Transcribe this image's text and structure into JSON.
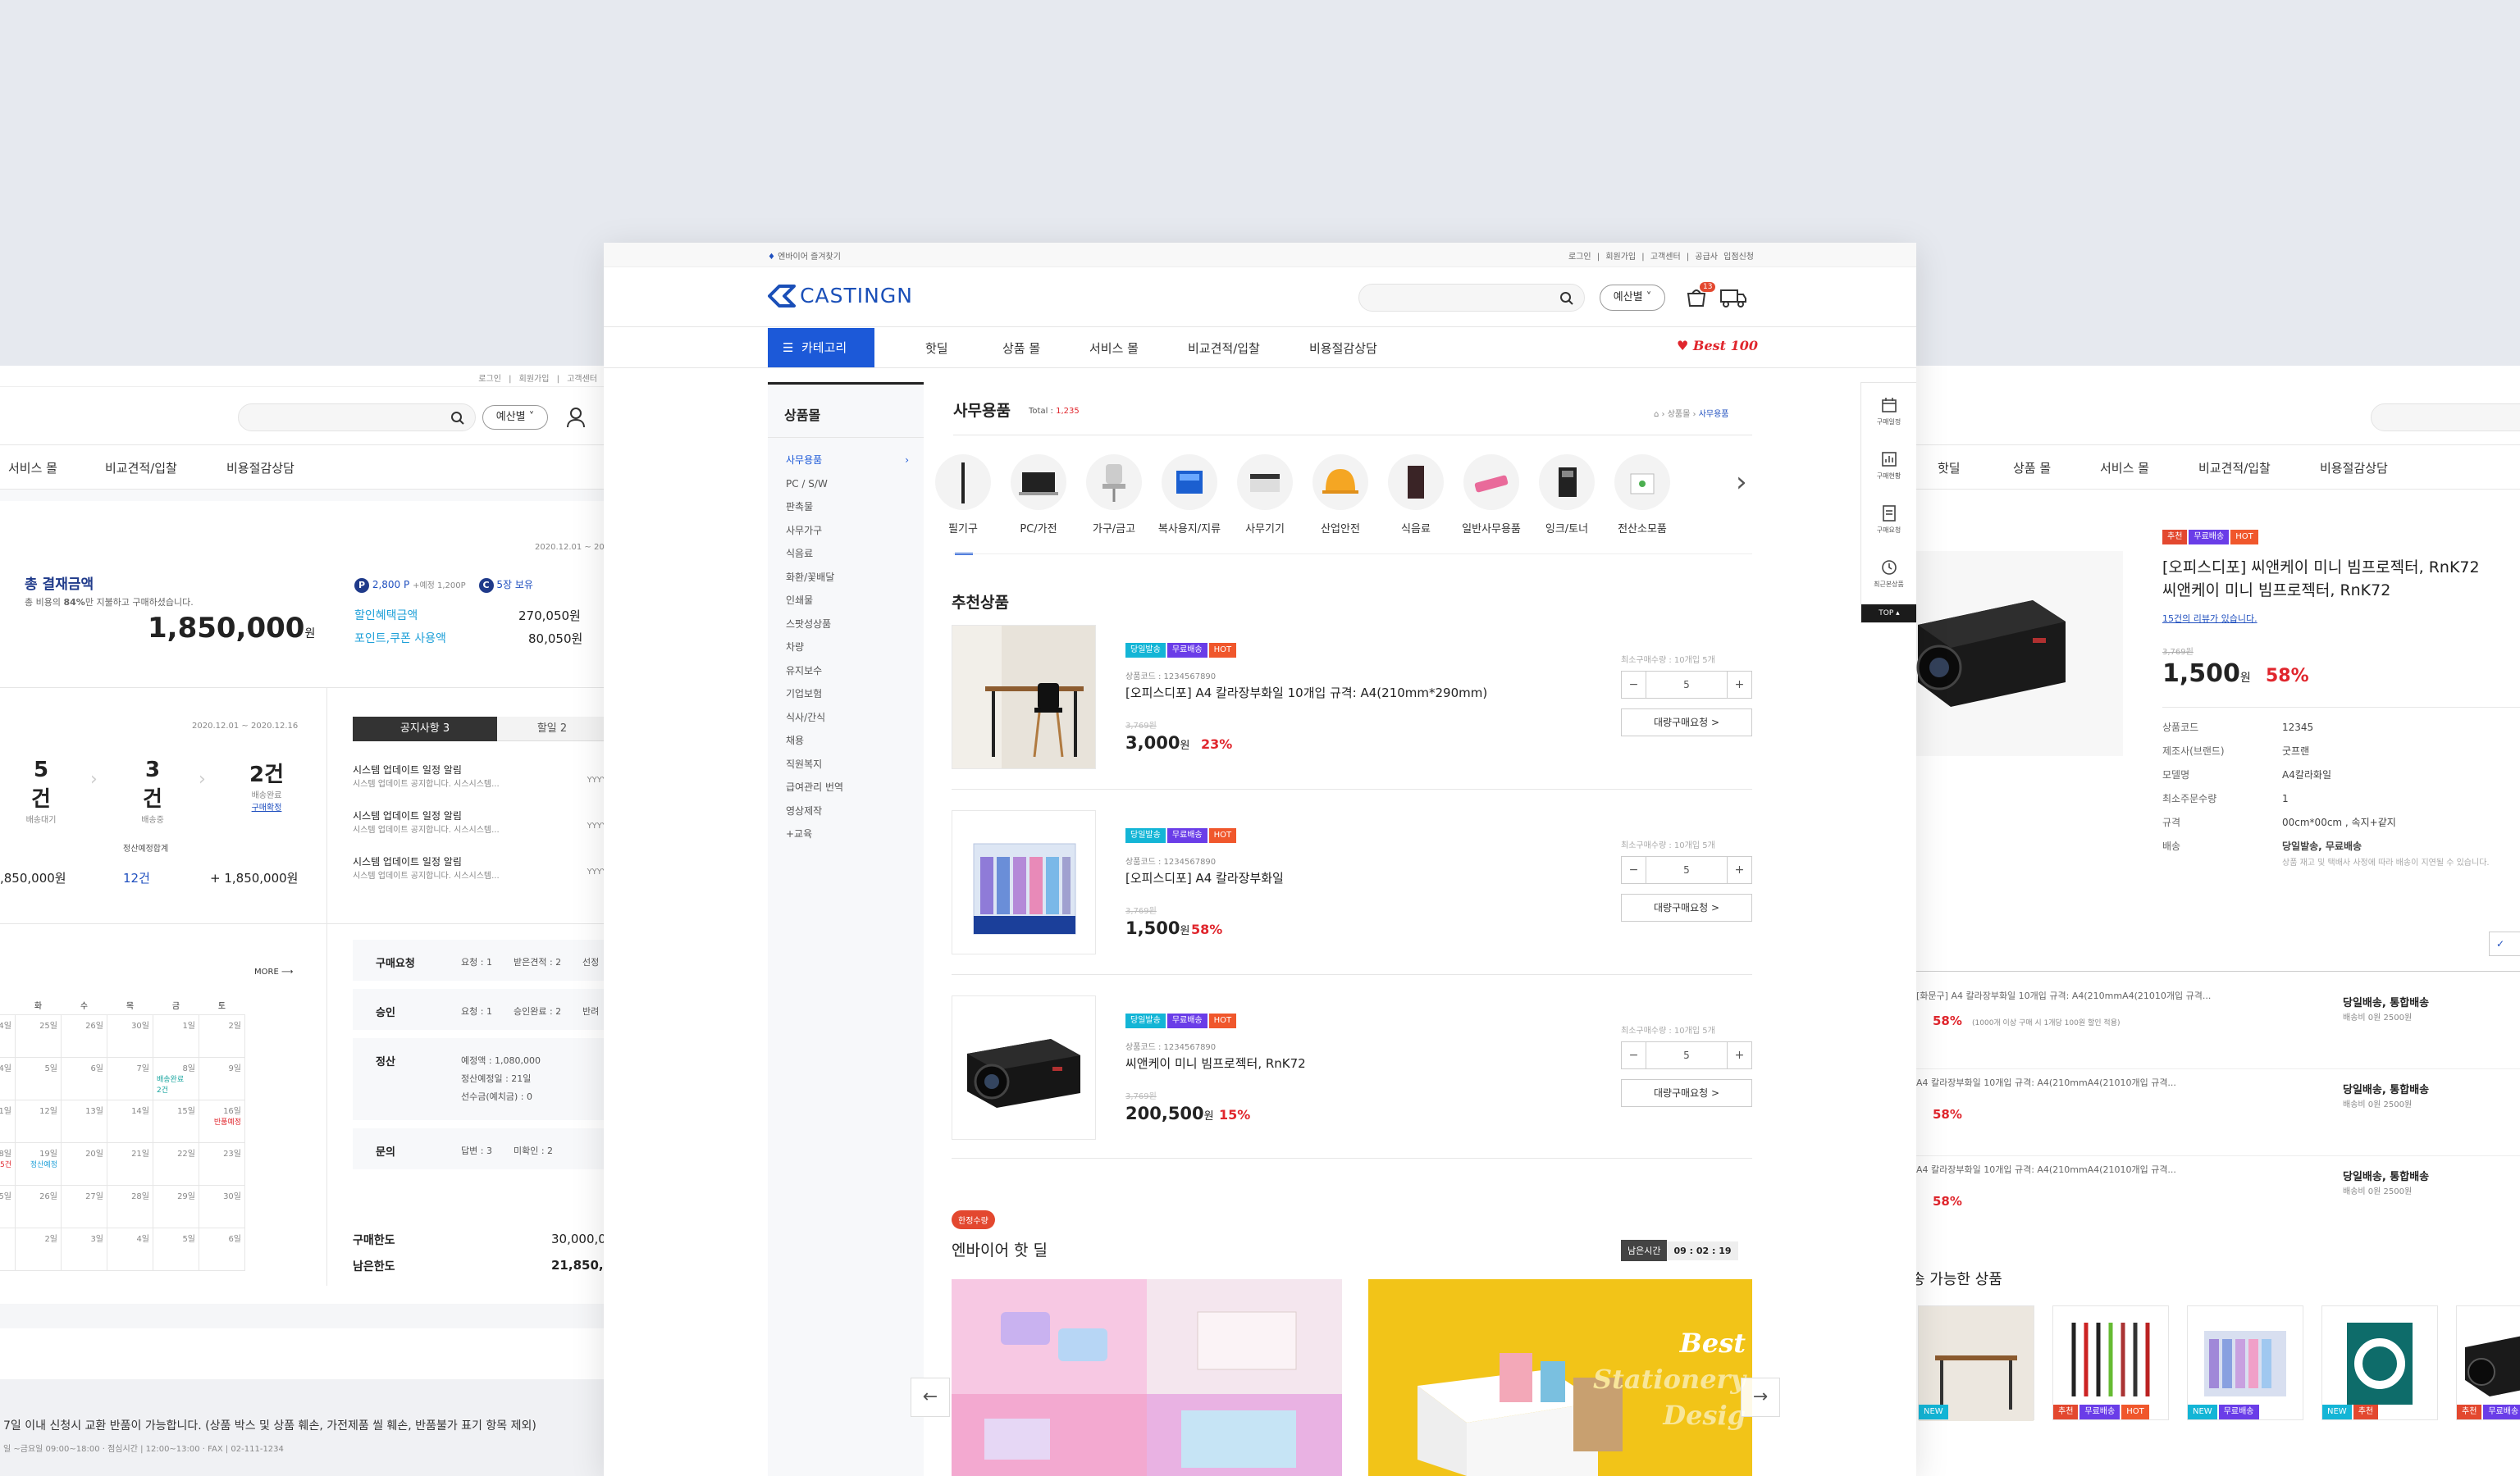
{
  "left": {
    "header_links": [
      "로그인",
      "회원가입",
      "고객센터"
    ],
    "budget_label": "예산별",
    "nav": [
      "서비스 몰",
      "비교견적/입찰",
      "비용절감상담"
    ],
    "summary": {
      "date_range": "2020.12.01 ~ 20",
      "title": "총 결재금액",
      "desc_pre": "총 비용의 ",
      "desc_pct": "84%",
      "desc_post": "만 지불하고 구매하셨습니다.",
      "total": "1,850,000",
      "won": "원",
      "points": "2,800 P",
      "points_expected": "+예정 1,200P",
      "coupons": "5장 보유",
      "discount_label": "할인혜택금액",
      "discount_value": "270,050원",
      "point_use_label": "포인트,쿠폰 사용액",
      "point_use_value": "80,050원"
    },
    "delivery": {
      "date_range": "2020.12.01 ~ 2020.12.16",
      "items": [
        {
          "count": "5건",
          "label": "배송대기"
        },
        {
          "count": "3건",
          "label": "배송중"
        },
        {
          "count": "2건",
          "label": "배송완료"
        }
      ],
      "confirm_link": "구매확정",
      "settle_label": "정산예정합계",
      "settle_amount": ",850,000원",
      "settle_count": "12건",
      "settle_total": "+ 1,850,000원"
    },
    "notice": {
      "tab1": "공지사항 3",
      "tab2": "할일 2",
      "items": [
        {
          "title": "시스템 업데이트 일정 알림",
          "sub": "시스템 업데이트 공지합니다. 시스시스템..."
        },
        {
          "title": "시스템 업데이트 일정 알림",
          "sub": "시스템 업데이트 공지합니다. 시스시스템..."
        },
        {
          "title": "시스템 업데이트 일정 알림",
          "sub": "시스템 업데이트 공지합니다. 시스시스템..."
        }
      ],
      "yyyy": "YYYY"
    },
    "calendar": {
      "more": "MORE",
      "days": [
        "화",
        "수",
        "목",
        "금",
        "토"
      ],
      "rows": [
        [
          "24일",
          "25일",
          "26일",
          "30일",
          "1일",
          "2일"
        ],
        [
          "4일",
          "5일",
          "6일",
          "7일",
          "8일",
          "9일"
        ],
        [
          "1일",
          "12일",
          "13일",
          "14일",
          "15일",
          "16일"
        ],
        [
          "8일",
          "19일",
          "20일",
          "21일",
          "22일",
          "23일"
        ],
        [
          "5일",
          "26일",
          "27일",
          "28일",
          "29일",
          "30일"
        ],
        [
          "",
          "2일",
          "3일",
          "4일",
          "5일",
          "6일"
        ]
      ],
      "events": {
        "delivery_done": "배송완료",
        "delivery_count": "2건",
        "return": "반품예정",
        "unpaid": "반품5건",
        "settle": "정산예정"
      }
    },
    "status": {
      "rows": [
        {
          "label": "구매요청",
          "a": "요청 : 1",
          "b": "받은견적 : 2",
          "c": "선정"
        },
        {
          "label": "승인",
          "a": "요청 : 1",
          "b": "승인완료 : 2",
          "c": "반려"
        },
        {
          "label": "정산",
          "a": "예정액 : 1,080,000",
          "b": "정산예정일 : 21일",
          "c": "선수금(예치금) : 0"
        },
        {
          "label": "문의",
          "a": "답변 : 3",
          "b": "미확인 : 2",
          "c": ""
        }
      ],
      "limit_label": "구매한도",
      "limit_value": "30,000,0",
      "remain_label": "남은한도",
      "remain_value": "21,850,0"
    },
    "footer": {
      "line1": "7일 이내 신청시 교환 반품이 가능합니다. (상품 박스 및 상품 훼손, 가전제품 씰 훼손, 반품불가 표기 항목 제외)",
      "line2": "일 ~금요일 09:00~18:00 · 점심시간 | 12:00~13:00 · FAX | 02-111-1234"
    }
  },
  "main": {
    "top_left": "엔바이어 즐겨찾기",
    "top_links": [
      "로그인",
      "회원가입",
      "고객센터",
      "공급사 입점신청"
    ],
    "logo": "CASTINGN",
    "budget_label": "예산별",
    "cart_count": "13",
    "category_btn": "카테고리",
    "nav": [
      "핫딜",
      "상품 몰",
      "서비스 몰",
      "비교견적/입찰",
      "비용절감상담"
    ],
    "best": "Best 100",
    "sidebar": {
      "title": "상품몰",
      "items": [
        "사무용품",
        "PC / S/W",
        "판촉물",
        "사무가구",
        "식음료",
        "화환/꽃배달",
        "인쇄물",
        "스팟성상품",
        "차량",
        "유지보수",
        "기업보험",
        "식사/간식",
        "채용",
        "직원복지",
        "급여관리 번역",
        "영상제작",
        "+교육"
      ]
    },
    "section": {
      "title": "사무용품",
      "total_label": "Total :",
      "total": "1,235",
      "breadcrumb": [
        "상품몰",
        "사무용품"
      ]
    },
    "categories": [
      "필기구",
      "PC/가전",
      "가구/금고",
      "복사용지/지류",
      "사무기기",
      "산업안전",
      "식음료",
      "일반사무용품",
      "잉크/토너",
      "전산소모품"
    ],
    "recommended_title": "추천상품",
    "products": [
      {
        "badges": [
          "당일발송",
          "무료배송",
          "HOT"
        ],
        "code": "상품코드 : 1234567890",
        "name": "[오피스디포] A4 칼라장부화일 10개입 규격: A4(210mm*290mm)",
        "old": "3,769원",
        "price": "3,000",
        "won": "원",
        "pct": "23%",
        "min": "최소구매수량 : 10개입 5개",
        "qty": "5",
        "bulk": "대량구매요청 >"
      },
      {
        "badges": [
          "당일발송",
          "무료배송",
          "HOT"
        ],
        "code": "상품코드 : 1234567890",
        "name": "[오피스디포] A4 칼라장부화일",
        "old": "3,769원",
        "price": "1,500",
        "won": "원",
        "pct": "58%",
        "min": "최소구매수량 : 10개입 5개",
        "qty": "5",
        "bulk": "대량구매요청 >"
      },
      {
        "badges": [
          "당일발송",
          "무료배송",
          "HOT"
        ],
        "code": "상품코드 : 1234567890",
        "name": "씨앤케이 미니 빔프로젝터,  RnK72",
        "old": "3,769원",
        "price": "200,500",
        "won": "원",
        "pct": "15%",
        "min": "최소구매수량 : 10개입 5개",
        "qty": "5",
        "bulk": "대량구매요청 >"
      }
    ],
    "hotdeal": {
      "badge": "한정수량",
      "title": "엔바이어 핫 딜",
      "remain_label": "남은시간",
      "remain_time": "09 : 02 : 19",
      "banner_text1": "Best",
      "banner_text2": "Stationery",
      "banner_text3": "Desig"
    },
    "quick": {
      "items": [
        "구매일정",
        "구매현황",
        "구매요청",
        "최근본상품"
      ],
      "top": "TOP"
    }
  },
  "right": {
    "nav": [
      "핫딜",
      "상품 몰",
      "서비스 몰",
      "비교견적/입찰",
      "비용절감상담"
    ],
    "detail": {
      "badges": [
        "추천",
        "무료배송",
        "HOT"
      ],
      "title": "[오피스디포] 씨앤케이 미니 빔프로젝터, RnK72\n씨앤케이 미니 빔프로젝터, RnK72",
      "review": "15건의 리뷰가 있습니다.",
      "old": "3,769원",
      "price": "1,500",
      "won": "원",
      "pct": "58%",
      "specs": [
        {
          "k": "상품코드",
          "v": "12345"
        },
        {
          "k": "제조사(브랜드)",
          "v": "굿프랜"
        },
        {
          "k": "모델명",
          "v": "A4칼라화일"
        },
        {
          "k": "최소주문수량",
          "v": "1"
        },
        {
          "k": "규격",
          "v": "00cm*00cm , 속지+같지"
        },
        {
          "k": "배송",
          "v": "당일발송, 무료배송"
        }
      ],
      "ship_note": "상품 재고 및 택배사 사정에 따라 배송이 지연될 수 있습니다."
    },
    "list": [
      {
        "name": "[화문구] A4 칼라장부화일 10개입 규격: A4(210mmA4(21010개입 규격...",
        "pct": "58%",
        "note": "(1000개 이상 구매 시 1개당 100원 할인 적용)",
        "ship": "당일배송, 통합배송",
        "fee": "배송비 0원 2500원"
      },
      {
        "name": "A4 칼라장부화일 10개입 규격: A4(210mmA4(21010개입 규격...",
        "pct": "58%",
        "note": "",
        "ship": "당일배송, 통합배송",
        "fee": "배송비 0원 2500원"
      },
      {
        "name": "A4 칼라장부화일 10개입 규격: A4(210mmA4(21010개입 규격...",
        "pct": "58%",
        "note": "",
        "ship": "당일배송, 통합배송",
        "fee": "배송비 0원 2500원"
      }
    ],
    "also_title": "송 가능한 상품",
    "thumb_badges": [
      [
        "NEW"
      ],
      [
        "추천",
        "무료배송",
        "HOT"
      ],
      [
        "NEW",
        "무료배송"
      ],
      [
        "NEW",
        "추천"
      ],
      [
        "추천",
        "무료배송"
      ]
    ]
  }
}
